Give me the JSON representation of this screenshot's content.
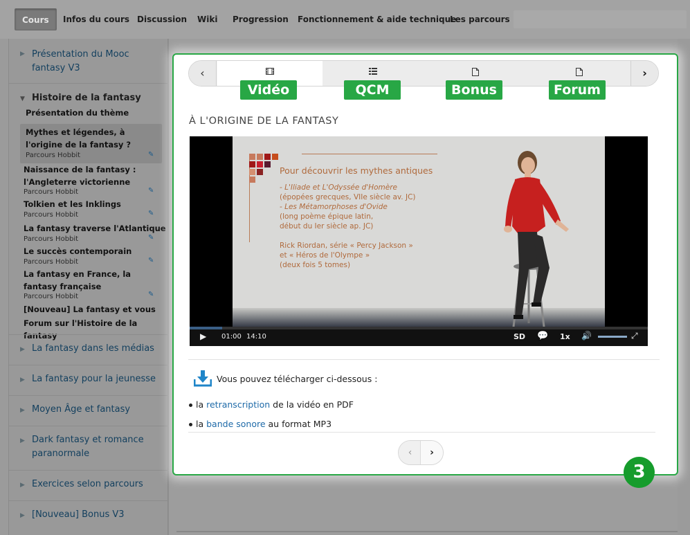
{
  "topnav": {
    "items": [
      "Cours",
      "Infos du cours",
      "Discussion",
      "Wiki",
      "Progression",
      "Fonctionnement & aide technique",
      "Les parcours"
    ]
  },
  "sidebar": {
    "chapters_top": [
      "Présentation du Mooc fantasy V3"
    ],
    "open_chapter": "Histoire de la fantasy",
    "open_intro": "Présentation du thème",
    "subsections": [
      {
        "title": "Mythes et légendes, à l'origine de la fantasy ?",
        "tag": "Parcours Hobbit"
      },
      {
        "title": "Naissance de la fantasy : l'Angleterre victorienne",
        "tag": "Parcours Hobbit"
      },
      {
        "title": "Tolkien et les Inklings",
        "tag": "Parcours Hobbit"
      },
      {
        "title": "La fantasy traverse l'Atlantique",
        "tag": "Parcours Hobbit"
      },
      {
        "title": "Le succès contemporain",
        "tag": "Parcours Hobbit"
      },
      {
        "title": "La fantasy en France, la fantasy française",
        "tag": "Parcours Hobbit"
      },
      {
        "title": "[Nouveau] La fantasy et vous",
        "tag": ""
      },
      {
        "title": "Forum sur l'Histoire de la fantasy",
        "tag": ""
      }
    ],
    "chapters_bottom": [
      "La fantasy dans les médias",
      "La fantasy pour la jeunesse",
      "Moyen Âge et fantasy",
      "Dark fantasy et romance paranormale",
      "Exercices selon parcours",
      "[Nouveau] Bonus V3"
    ]
  },
  "unit_tabs": {
    "labels": [
      "Vidéo",
      "QCM",
      "Bonus",
      "Forum"
    ],
    "icons": [
      "film-icon",
      "list-icon",
      "document-icon",
      "document-icon"
    ],
    "active_index": 0
  },
  "unit_title": "À L'ORIGINE DE LA FANTASY",
  "video": {
    "slide_heading": "Pour découvrir les mythes antiques",
    "slide_lines": [
      "- L'Iliade et L'Odyssée d'Homère",
      "(épopées grecques, VIIe siècle av. JC)",
      "- Les Métamorphoses d'Ovide",
      "(long poème épique latin,",
      "début du Ier siècle ap. JC)",
      "",
      "Rick Riordan, série « Percy Jackson »",
      "et « Héros de l'Olympe »",
      "(deux fois 5 tomes)"
    ],
    "elapsed": "01:00",
    "duration": "14:10",
    "quality": "SD",
    "speed": "1x",
    "progress_fraction": 0.071
  },
  "downloads": {
    "intro": "Vous pouvez télécharger ci-dessous :",
    "items": [
      {
        "prefix": "la",
        "link": "retranscription",
        "suffix": "de la vidéo en PDF"
      },
      {
        "prefix": "la",
        "link": "bande sonore",
        "suffix": "au format MP3"
      }
    ]
  },
  "step_badge": "3",
  "colors": {
    "accent_green": "#28a745",
    "link_blue": "#1e6aa8",
    "sidebar_link": "#123f5e"
  }
}
